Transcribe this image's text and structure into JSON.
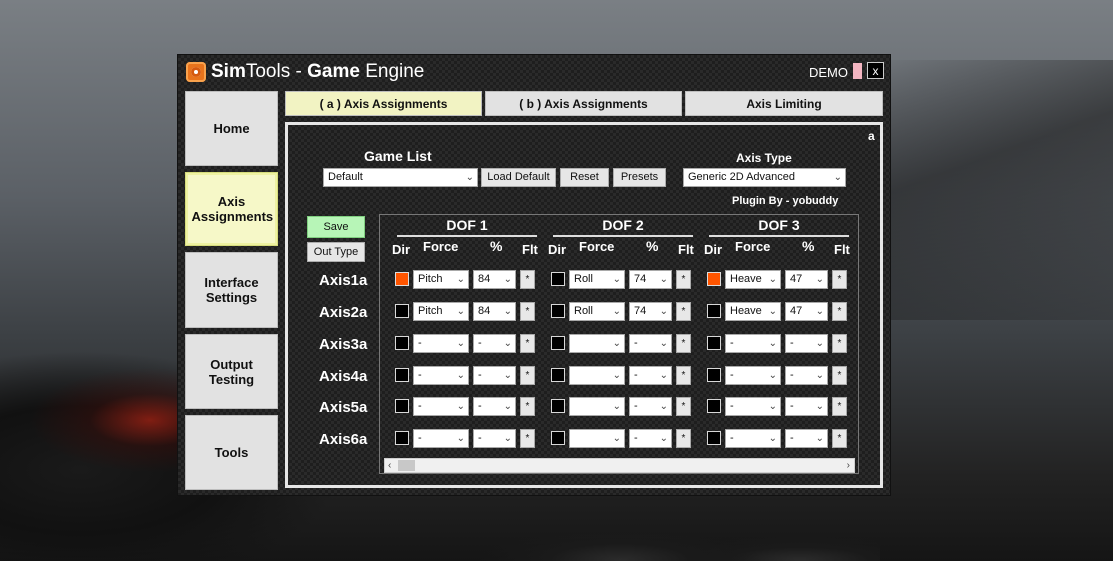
{
  "app": {
    "title_part1": "Sim",
    "title_part2": "Tools - ",
    "title_part3": "Game",
    "title_part4": " Engine",
    "demo_label": "DEMO",
    "close_label": "x"
  },
  "nav": [
    {
      "label": "Home"
    },
    {
      "label": "Axis Assignments"
    },
    {
      "label": "Interface Settings"
    },
    {
      "label": "Output Testing"
    },
    {
      "label": "Tools"
    }
  ],
  "tabs": [
    {
      "label": "( a ) Axis Assignments"
    },
    {
      "label": "( b ) Axis Assignments"
    },
    {
      "label": "Axis Limiting"
    }
  ],
  "panel": {
    "corner_label": "a",
    "game_list_label": "Game List",
    "game_list_value": "Default",
    "load_default": "Load Default",
    "reset": "Reset",
    "presets": "Presets",
    "axis_type_label": "Axis Type",
    "axis_type_value": "Generic 2D Advanced",
    "plugin_by": "Plugin By - yobuddy",
    "save": "Save",
    "out_type": "Out Type"
  },
  "dofs": [
    {
      "title": "DOF 1",
      "dir_label": "Dir",
      "force_label": "Force",
      "pct_label": "%",
      "flt_label": "Flt"
    },
    {
      "title": "DOF 2",
      "dir_label": "Dir",
      "force_label": "Force",
      "pct_label": "%",
      "flt_label": "Flt"
    },
    {
      "title": "DOF 3",
      "dir_label": "Dir",
      "force_label": "Force",
      "pct_label": "%",
      "flt_label": "Flt"
    }
  ],
  "rows": [
    {
      "axis": "Axis1a",
      "cells": [
        {
          "dir": true,
          "force": "Pitch",
          "pct": "84",
          "flt": "*"
        },
        {
          "dir": false,
          "force": "Roll",
          "pct": "74",
          "flt": "*"
        },
        {
          "dir": true,
          "force": "Heave",
          "pct": "47",
          "flt": "*"
        }
      ]
    },
    {
      "axis": "Axis2a",
      "cells": [
        {
          "dir": false,
          "force": "Pitch",
          "pct": "84",
          "flt": "*"
        },
        {
          "dir": false,
          "force": "Roll",
          "pct": "74",
          "flt": "*"
        },
        {
          "dir": false,
          "force": "Heave",
          "pct": "47",
          "flt": "*"
        }
      ]
    },
    {
      "axis": "Axis3a",
      "cells": [
        {
          "dir": false,
          "force": "-",
          "pct": "-",
          "flt": "*"
        },
        {
          "dir": false,
          "force": "",
          "pct": "-",
          "flt": "*"
        },
        {
          "dir": false,
          "force": "-",
          "pct": "-",
          "flt": "*"
        }
      ]
    },
    {
      "axis": "Axis4a",
      "cells": [
        {
          "dir": false,
          "force": "-",
          "pct": "-",
          "flt": "*"
        },
        {
          "dir": false,
          "force": "",
          "pct": "-",
          "flt": "*"
        },
        {
          "dir": false,
          "force": "-",
          "pct": "-",
          "flt": "*"
        }
      ]
    },
    {
      "axis": "Axis5a",
      "cells": [
        {
          "dir": false,
          "force": "-",
          "pct": "-",
          "flt": "*"
        },
        {
          "dir": false,
          "force": "",
          "pct": "-",
          "flt": "*"
        },
        {
          "dir": false,
          "force": "-",
          "pct": "-",
          "flt": "*"
        }
      ]
    },
    {
      "axis": "Axis6a",
      "cells": [
        {
          "dir": false,
          "force": "-",
          "pct": "-",
          "flt": "*"
        },
        {
          "dir": false,
          "force": "",
          "pct": "-",
          "flt": "*"
        },
        {
          "dir": false,
          "force": "-",
          "pct": "-",
          "flt": "*"
        }
      ]
    }
  ],
  "colors": {
    "dir_on": "#ff5500",
    "active_nav": "#f6f8c8",
    "save_button": "#b7f5b7"
  },
  "icons": {
    "dropdown": "chevron-down-icon",
    "scroll_left": "chevron-left-icon",
    "scroll_right": "chevron-right-icon"
  }
}
